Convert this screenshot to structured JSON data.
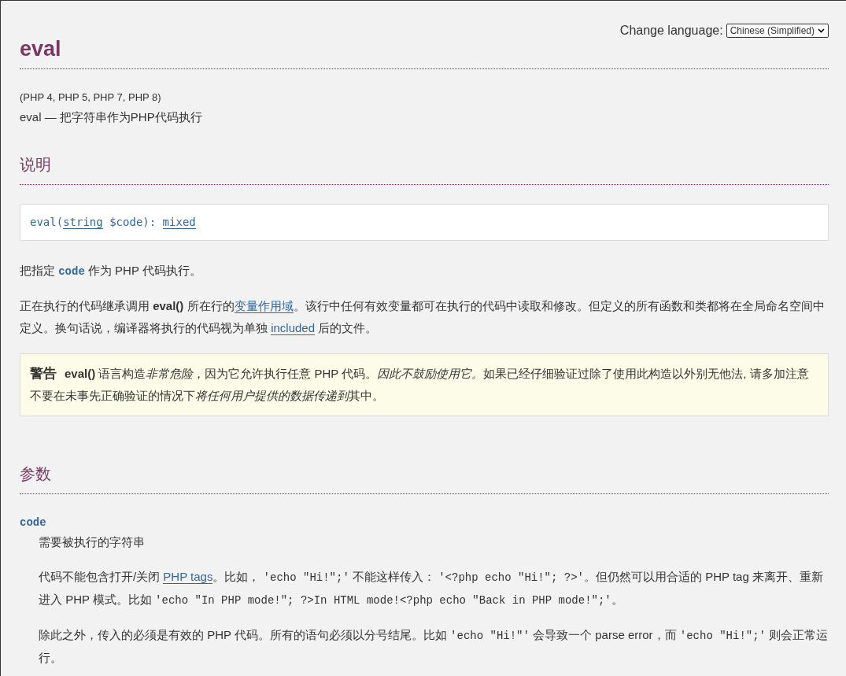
{
  "language_switcher": {
    "label": "Change language:",
    "value": "Chinese (Simplified)"
  },
  "title": "eval",
  "versions": "(PHP 4, PHP 5, PHP 7, PHP 8)",
  "purpose": "eval — 把字符串作为PHP代码执行",
  "description": {
    "heading": "说明",
    "signature": [
      {
        "kind": "text",
        "text": "eval("
      },
      {
        "kind": "link",
        "text": "string"
      },
      {
        "kind": "text",
        "text": " $code): "
      },
      {
        "kind": "link",
        "text": "mixed"
      }
    ],
    "paragraphs": [
      [
        {
          "kind": "text",
          "text": "把指定 "
        },
        {
          "kind": "param",
          "text": "code"
        },
        {
          "kind": "text",
          "text": " 作为 PHP 代码执行。"
        }
      ],
      [
        {
          "kind": "text",
          "text": "正在执行的代码继承调用 "
        },
        {
          "kind": "bold",
          "text": "eval()"
        },
        {
          "kind": "text",
          "text": " 所在行的"
        },
        {
          "kind": "link",
          "text": "变量作用域"
        },
        {
          "kind": "text",
          "text": "。该行中任何有效变量都可在执行的代码中读取和修改。但定义的所有函数和类都将在全局命名空间中定义。换句话说，编译器将执行的代码视为单独 "
        },
        {
          "kind": "link",
          "text": "included"
        },
        {
          "kind": "text",
          "text": " 后的文件。"
        }
      ]
    ],
    "warning": {
      "label": "警告",
      "text": [
        {
          "kind": "bold",
          "text": "eval()"
        },
        {
          "kind": "text",
          "text": " 语言构造"
        },
        {
          "kind": "italic",
          "text": "非常危险"
        },
        {
          "kind": "text",
          "text": "，因为它允许执行任意 PHP 代码。"
        },
        {
          "kind": "italic",
          "text": "因此不鼓励使用它。"
        },
        {
          "kind": "text",
          "text": "如果已经仔细验证过除了使用此构造以外别无他法, 请多加注意不要在未事先正确验证的情况下"
        },
        {
          "kind": "italic",
          "text": "将任何用户提供的数据传递到"
        },
        {
          "kind": "text",
          "text": "其中。"
        }
      ]
    }
  },
  "parameters": {
    "heading": "参数",
    "items": [
      {
        "name": "code",
        "paragraphs": [
          [
            {
              "kind": "text",
              "text": "需要被执行的字符串"
            }
          ],
          [
            {
              "kind": "text",
              "text": "代码不能包含打开/关闭 "
            },
            {
              "kind": "link",
              "text": "PHP tags"
            },
            {
              "kind": "text",
              "text": "。比如， "
            },
            {
              "kind": "code",
              "text": "'echo \"Hi!\";'"
            },
            {
              "kind": "text",
              "text": " 不能这样传入： "
            },
            {
              "kind": "code",
              "text": "'<?php echo \"Hi!\"; ?>'"
            },
            {
              "kind": "text",
              "text": "。但仍然可以用合适的 PHP tag 来离开、重新进入 PHP 模式。比如 "
            },
            {
              "kind": "code",
              "text": "'echo \"In PHP mode!\"; ?>In HTML mode!<?php echo \"Back in PHP mode!\";'"
            },
            {
              "kind": "text",
              "text": "。"
            }
          ],
          [
            {
              "kind": "text",
              "text": "除此之外，传入的必须是有效的 PHP 代码。所有的语句必须以分号结尾。比如 "
            },
            {
              "kind": "code",
              "text": "'echo \"Hi!\"'"
            },
            {
              "kind": "text",
              "text": " 会导致一个 parse error，而 "
            },
            {
              "kind": "code",
              "text": "'echo \"Hi!\";'"
            },
            {
              "kind": "text",
              "text": " 则会正常运行。"
            }
          ]
        ]
      }
    ]
  }
}
